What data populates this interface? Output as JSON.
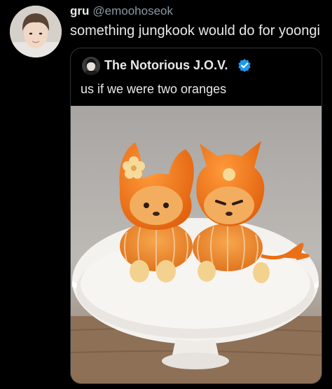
{
  "tweet": {
    "display_name": "gru",
    "handle": "@emoohoseok",
    "text": "something jungkook would do for yoongi",
    "avatar_icon": "profile-photo"
  },
  "quoted_tweet": {
    "display_name": "The Notorious J.O.V.",
    "verified": true,
    "verified_color": "#1d9bf0",
    "text": "us if we were two oranges",
    "avatar_icon": "profile-photo",
    "media_icon": "photo-two-orange-figures"
  },
  "colors": {
    "background": "#000000",
    "text_primary": "#e7e9ea",
    "text_secondary": "#8b98a5",
    "border": "#2f3336",
    "orange": "#f07a1a"
  }
}
